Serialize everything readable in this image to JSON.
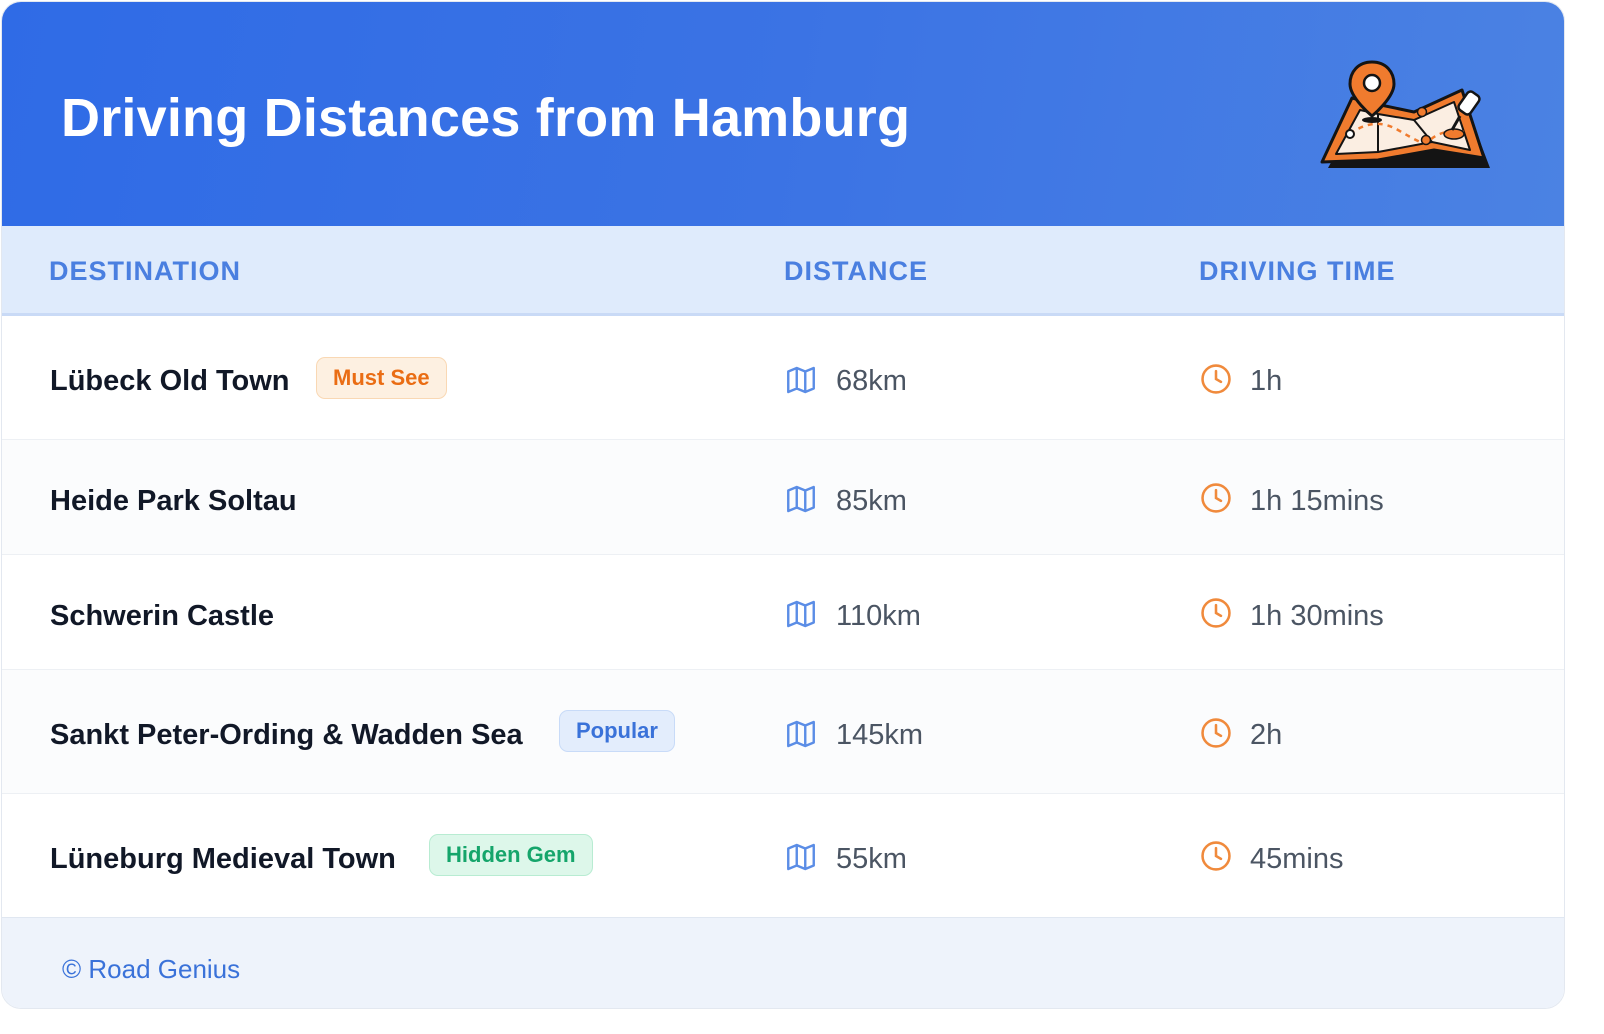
{
  "header": {
    "title": "Driving Distances from Hamburg",
    "illustration_icon": "folded-map-with-location-pin-icon"
  },
  "columns": {
    "destination": "DESTINATION",
    "distance": "DISTANCE",
    "driving_time": "DRIVING TIME"
  },
  "rows": [
    {
      "destination": "Lübeck Old Town",
      "badge": "Must See",
      "distance": "68km",
      "time": "1h"
    },
    {
      "destination": "Heide Park Soltau",
      "badge": "",
      "distance": "85km",
      "time": "1h 15mins"
    },
    {
      "destination": "Schwerin Castle",
      "badge": "",
      "distance": "110km",
      "time": "1h 30mins"
    },
    {
      "destination": "Sankt Peter-Ording & Wadden Sea",
      "badge": "Popular",
      "distance": "145km",
      "time": "2h"
    },
    {
      "destination": "Lüneburg Medieval Town",
      "badge": "Hidden Gem",
      "distance": "55km",
      "time": "45mins"
    }
  ],
  "icons": {
    "distance": "map-icon",
    "time": "clock-icon"
  },
  "footer": {
    "copyright": "© Road Genius"
  },
  "colors": {
    "header_start": "#2f6be6",
    "header_end": "#4b82e3",
    "column_header_text": "#4a7fe0",
    "distance_icon": "#5b8de6",
    "time_icon": "#f08a3c",
    "badge_must_see": "#ea6d14",
    "badge_popular": "#3a72d9",
    "badge_hidden_gem": "#15a56b"
  }
}
